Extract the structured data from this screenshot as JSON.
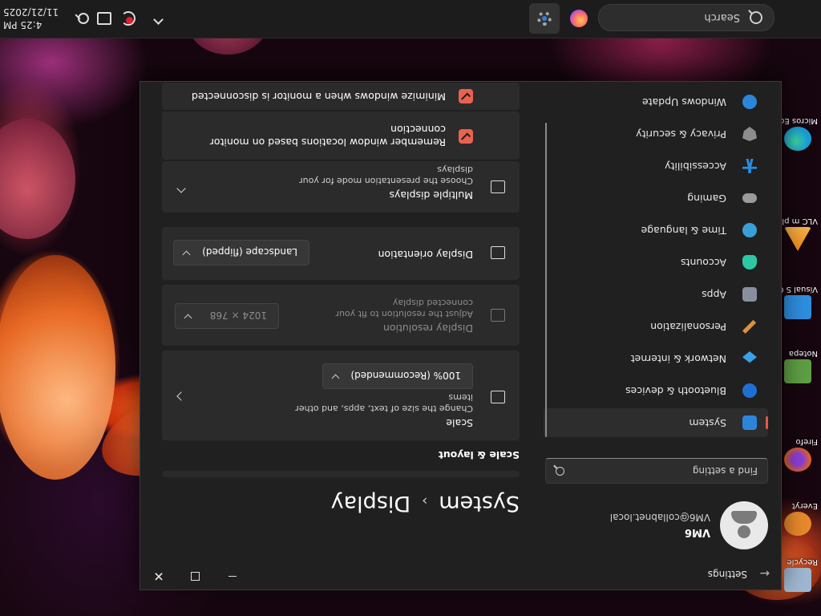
{
  "taskbar": {
    "search_placeholder": "Search",
    "time": "4:25 PM",
    "date": "11/21/2025"
  },
  "desktop_icons": [
    {
      "label": "Recycle",
      "color": "#9fb7d0"
    },
    {
      "label": "Everyt",
      "color": "#e88a2c"
    },
    {
      "label": "Firefo",
      "color": "#e2621b"
    },
    {
      "label": "Notepa",
      "color": "#5e9f45"
    },
    {
      "label": "Visual S Code",
      "color": "#2f8fe0"
    },
    {
      "label": "VLC m play",
      "color": "#f08a10"
    },
    {
      "label": "Micros Edge",
      "color": "#1a9bd6"
    }
  ],
  "window": {
    "app_title": "Settings",
    "user_name": "VM6",
    "user_email": "VM6@collabnet.local",
    "find_placeholder": "Find a setting",
    "breadcrumb_parent": "System",
    "breadcrumb_sep": "›",
    "breadcrumb_current": "Display",
    "nav": [
      {
        "label": "System",
        "icon": "system-icon",
        "color": "#2b86d9"
      },
      {
        "label": "Bluetooth & devices",
        "icon": "bluetooth-icon",
        "color": "#1f6fd1"
      },
      {
        "label": "Network & internet",
        "icon": "network-icon",
        "color": "#3aa0e8"
      },
      {
        "label": "Personalization",
        "icon": "brush-icon",
        "color": "#e0903a"
      },
      {
        "label": "Apps",
        "icon": "apps-icon",
        "color": "#8a8fa0"
      },
      {
        "label": "Accounts",
        "icon": "accounts-icon",
        "color": "#2ec7a3"
      },
      {
        "label": "Time & language",
        "icon": "globe-clock-icon",
        "color": "#3a9fd8"
      },
      {
        "label": "Gaming",
        "icon": "gamepad-icon",
        "color": "#9a9a9a"
      },
      {
        "label": "Accessibility",
        "icon": "accessibility-icon",
        "color": "#2a8de0"
      },
      {
        "label": "Privacy & security",
        "icon": "shield-icon",
        "color": "#8d8d8d"
      },
      {
        "label": "Windows Update",
        "icon": "update-icon",
        "color": "#2b86d9"
      }
    ],
    "section_title": "Scale & layout",
    "scale": {
      "title": "Scale",
      "subtitle": "Change the size of text, apps, and other items",
      "value": "100% (Recommended)"
    },
    "resolution": {
      "title": "Display resolution",
      "subtitle": "Adjust the resolution to fit your connected display",
      "value": "1024 × 768"
    },
    "orientation": {
      "title": "Display orientation",
      "value": "Landscape (flipped)"
    },
    "multiple": {
      "title": "Multiple displays",
      "subtitle": "Choose the presentation mode for your displays"
    },
    "checkboxes": [
      {
        "label": "Remember window locations based on monitor connection",
        "checked": true
      },
      {
        "label": "Minimize windows when a monitor is disconnected",
        "checked": true
      }
    ]
  }
}
